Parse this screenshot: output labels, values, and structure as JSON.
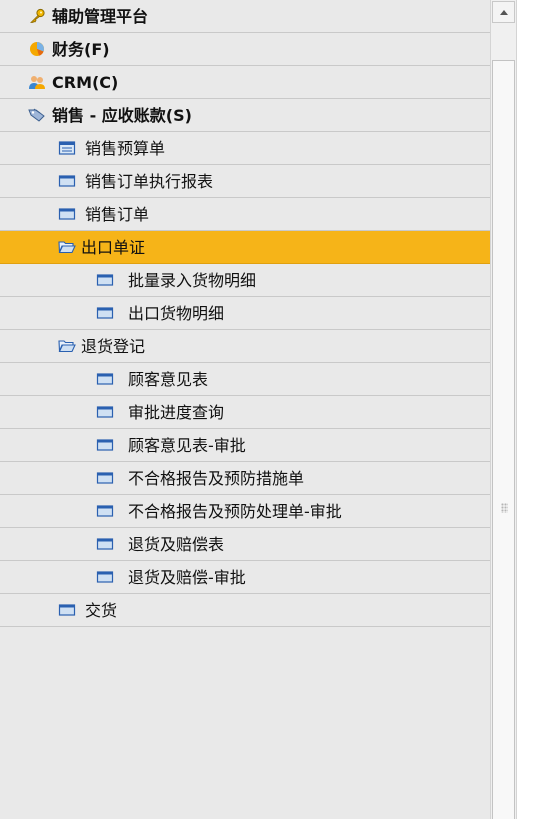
{
  "tree": {
    "items": [
      {
        "label": "辅助管理平台",
        "icon": "key-icon",
        "level": 0
      },
      {
        "label": "财务(F)",
        "icon": "pie-chart-icon",
        "level": 0
      },
      {
        "label": "CRM(C)",
        "icon": "users-icon",
        "level": 0
      },
      {
        "label": "销售 - 应收账款(S)",
        "icon": "sales-icon",
        "level": 0
      },
      {
        "label": "销售预算单",
        "icon": "form-icon",
        "level": 1
      },
      {
        "label": "销售订单执行报表",
        "icon": "window-icon",
        "level": 1
      },
      {
        "label": "销售订单",
        "icon": "window-icon",
        "level": 1
      },
      {
        "label": "出口单证",
        "icon": "folder-open-icon",
        "level": 1,
        "selected": true
      },
      {
        "label": "批量录入货物明细",
        "icon": "window-icon",
        "level": 2
      },
      {
        "label": "出口货物明细",
        "icon": "window-icon",
        "level": 2
      },
      {
        "label": "退货登记",
        "icon": "folder-open-icon",
        "level": 1
      },
      {
        "label": "顾客意见表",
        "icon": "window-icon",
        "level": 2
      },
      {
        "label": "审批进度查询",
        "icon": "window-icon",
        "level": 2
      },
      {
        "label": "顾客意见表-审批",
        "icon": "window-icon",
        "level": 2
      },
      {
        "label": "不合格报告及预防措施单",
        "icon": "window-icon",
        "level": 2
      },
      {
        "label": "不合格报告及预防处理单-审批",
        "icon": "window-icon",
        "level": 2
      },
      {
        "label": "退货及赔偿表",
        "icon": "window-icon",
        "level": 2
      },
      {
        "label": "退货及赔偿-审批",
        "icon": "window-icon",
        "level": 2
      },
      {
        "label": "交货",
        "icon": "window-icon",
        "level": 1
      }
    ]
  },
  "colors": {
    "selected": "#f6b418",
    "row_bg": "#e9e9e9",
    "window_icon": "#2a60b0"
  }
}
